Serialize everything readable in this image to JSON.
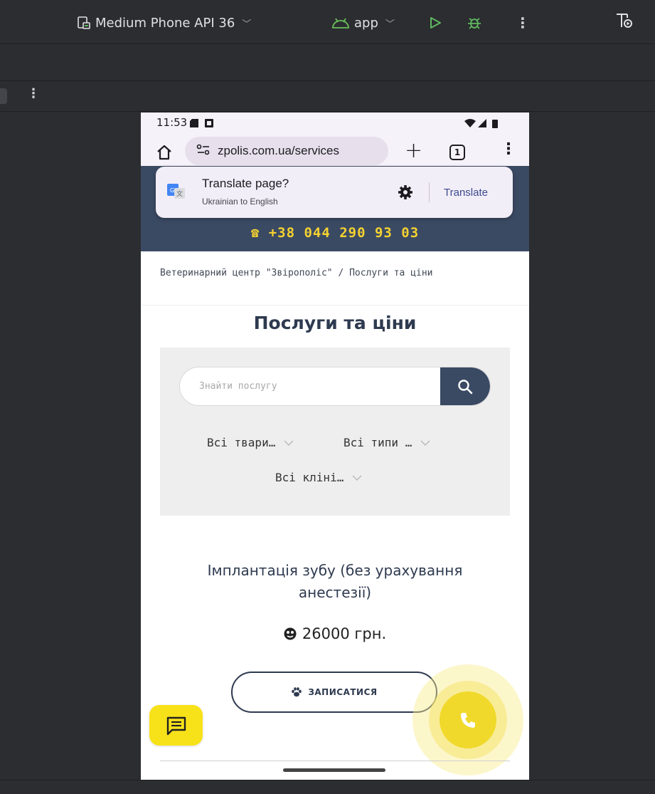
{
  "ide": {
    "device_selector": "Medium Phone API 36",
    "app_selector": "app",
    "icons": [
      "device-icon",
      "android-icon",
      "run-icon",
      "debug-icon",
      "more-vert-icon",
      "tool-icon"
    ]
  },
  "phone": {
    "status_bar": {
      "time": "11:53"
    },
    "browser": {
      "url": "zpolis.com.ua/services",
      "tab_count": "1"
    },
    "translate_popup": {
      "title": "Translate page?",
      "subtitle": "Ukrainian to English",
      "action": "Translate"
    },
    "site": {
      "header_phone": "☎ +38 044 290 93 03",
      "breadcrumb": "Ветеринарний центр \"Звірополіс\" /  Послуги та ціни",
      "page_title": "Послуги та ціни",
      "search_placeholder": "Знайти послугу",
      "filters": {
        "animals": "Всі твари…",
        "types": "Всі типи …",
        "clinics": "Всі клінi…"
      },
      "service": {
        "name": "Імплантація зубу (без урахування анестезії)",
        "price": "26000 грн.",
        "book_label": "ЗАПИСАТИСЯ"
      }
    },
    "colors": {
      "header_bg": "#3b4a63",
      "accent_yellow": "#f5d230",
      "call_button": "#f0d92a",
      "chat_button": "#f7e21a",
      "filter_panel_bg": "#eeeeee"
    }
  }
}
